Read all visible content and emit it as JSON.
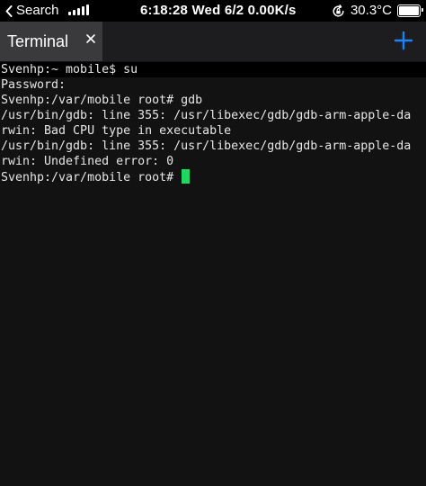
{
  "status_bar": {
    "back_label": "Search",
    "center_text": "6:18:28 Wed 6/2 0.00K/s",
    "temperature": "30.3°C",
    "battery_level": 1.0
  },
  "tabs": [
    {
      "label": "Terminal",
      "active": true
    }
  ],
  "icons": {
    "back": "chevron-left-icon",
    "signal": "cellular-signal-icon",
    "rotation_lock": "rotation-lock-icon",
    "battery": "battery-icon",
    "close_tab": "close-icon",
    "new_tab": "plus-icon"
  },
  "colors": {
    "accent": "#1a82ff",
    "cursor": "#1ed760",
    "terminal_bg": "#121212",
    "tab_active_bg": "#3a3a3c"
  },
  "terminal": {
    "lines": [
      "Svenhp:~ mobile$ su",
      "Password:",
      "Svenhp:/var/mobile root# gdb",
      "/usr/bin/gdb: line 355: /usr/libexec/gdb/gdb-arm-apple-da",
      "rwin: Bad CPU type in executable",
      "/usr/bin/gdb: line 355: /usr/libexec/gdb/gdb-arm-apple-da",
      "rwin: Undefined error: 0",
      "Svenhp:/var/mobile root# "
    ]
  }
}
